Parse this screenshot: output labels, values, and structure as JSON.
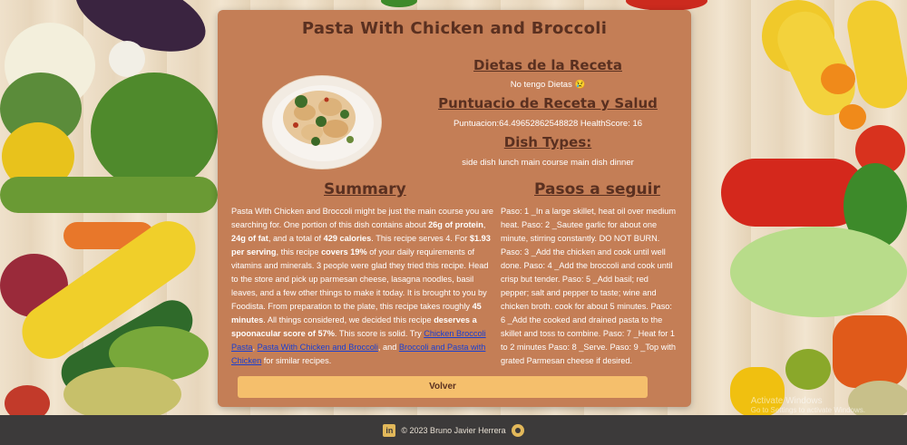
{
  "recipe": {
    "title": "Pasta With Chicken and Broccoli",
    "diets_heading": "Dietas de la Receta",
    "diets_text": "No tengo Dietas 😢",
    "score_heading": "Puntuacio de Receta y Salud",
    "score_text": "Puntuacion:64.49652862548828 HealthScore: 16",
    "dish_types_heading": "Dish Types:",
    "dish_types_text": "side dish lunch main course main dish dinner"
  },
  "summary": {
    "heading": "Summary",
    "t1": "Pasta With Chicken and Broccoli might be just the main course you are searching for. One portion of this dish contains about ",
    "b1": "26g of protein",
    "t2": ", ",
    "b2": "24g of fat",
    "t3": ", and a total of ",
    "b3": "429 calories",
    "t4": ". This recipe serves 4. For ",
    "b4": "$1.93 per serving",
    "t5": ", this recipe ",
    "b5": "covers 19%",
    "t6": " of your daily requirements of vitamins and minerals. 3 people were glad they tried this recipe. Head to the store and pick up parmesan cheese, lasagna noodles, basil leaves, and a few other things to make it today. It is brought to you by Foodista. From preparation to the plate, this recipe takes roughly ",
    "b6": "45 minutes",
    "t7": ". All things considered, we decided this recipe ",
    "b7": "deserves a spoonacular score of 57%",
    "t8": ". This score is solid. Try ",
    "link1": "Chicken Broccoli Pasta",
    "t9": ", ",
    "link2": "Pasta With Chicken and Broccoli",
    "t10": ", and ",
    "link3": "Broccoli and Pasta with Chicken",
    "t11": " for similar recipes."
  },
  "steps": {
    "heading": "Pasos a seguir",
    "text": "Paso: 1 _In a large skillet, heat oil over medium heat. Paso: 2 _Sautee garlic for about one minute, stirring constantly. DO NOT BURN. Paso: 3 _Add the chicken and cook until well done. Paso: 4 _Add the broccoli and cook until crisp but tender. Paso: 5 _Add basil; red pepper; salt and pepper to taste; wine and chicken broth. cook for about 5 minutes. Paso: 6 _Add the cooked and drained pasta to the skillet and toss to combine. Paso: 7 _Heat for 1 to 2 minutes Paso: 8 _Serve. Paso: 9 _Top with grated Parmesan cheese if desired."
  },
  "buttons": {
    "back_label": "Volver"
  },
  "footer": {
    "copyright": "© 2023 Bruno Javier Herrera",
    "linkedin_icon": "linkedin-icon",
    "github_icon": "github-icon"
  },
  "watermark": {
    "line1": "Activate Windows",
    "line2": "Go to Settings to activate Windows."
  },
  "colors": {
    "card": "#c47e56",
    "heading": "#5a3020",
    "button": "#f5bf6c",
    "footer": "#3c3a3a",
    "link": "#1a3fd0"
  }
}
